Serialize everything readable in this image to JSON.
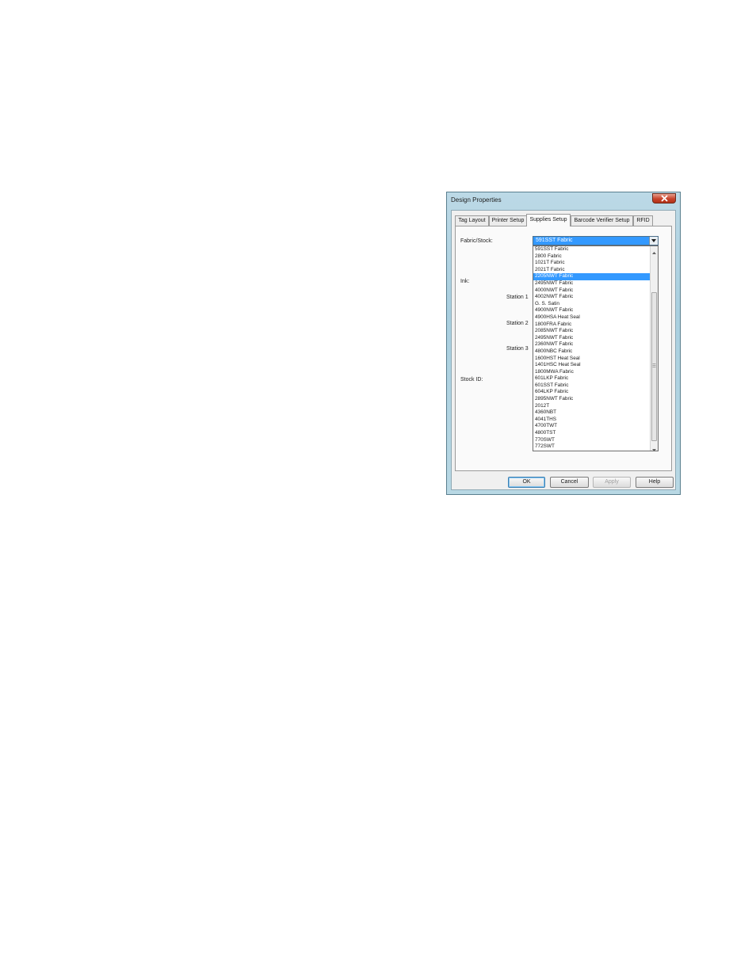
{
  "dialog": {
    "title": "Design Properties"
  },
  "tabs": [
    {
      "label": "Tag Layout"
    },
    {
      "label": "Printer Setup"
    },
    {
      "label": "Supplies Setup"
    },
    {
      "label": "Barcode Verifier Setup"
    },
    {
      "label": "RFID"
    }
  ],
  "active_tab": "Supplies Setup",
  "panel": {
    "fabric_stock_label": "Fabric/Stock:",
    "ink_label": "Ink:",
    "station1_label": "Station 1",
    "station2_label": "Station 2",
    "station3_label": "Station 3",
    "stock_id_label": "Stock ID:"
  },
  "fabric_combo": {
    "selected": "591SST Fabric",
    "options": [
      "591SST Fabric",
      "2800 Fabric",
      "1021T Fabric",
      "2021T Fabric",
      "2205NWT Fabric",
      "2495NWT Fabric",
      "4000NWT Fabric",
      "4002NWT Fabric",
      "G. S. Satin",
      "4900NWT Fabric",
      "4900HSA Heat Seal",
      "1800FRA Fabric",
      "2085NWT Fabric",
      "2495NWT Fabric",
      "2360NWT Fabric",
      "4800NBC Fabric",
      "1600HST Heat Seal",
      "1401HSC Heat Seal",
      "1800MWA Fabric",
      "601LKP Fabric",
      "601SST Fabric",
      "604LKP Fabric",
      "2895NWT Fabric",
      "2012T",
      "4360NBT",
      "4041THS",
      "4700TWT",
      "4800TST",
      "770SWT",
      "772SWT"
    ],
    "highlighted_index": 4
  },
  "buttons": {
    "ok": "OK",
    "cancel": "Cancel",
    "apply": "Apply",
    "help": "Help"
  },
  "icons": {
    "close": "close-icon",
    "dropdown": "chevron-down-icon",
    "scroll_up": "arrow-up-icon",
    "scroll_down": "arrow-down-icon"
  },
  "colors": {
    "selection": "#3399ff",
    "close_button": "#c8442c",
    "frame": "#a9cfdf"
  }
}
